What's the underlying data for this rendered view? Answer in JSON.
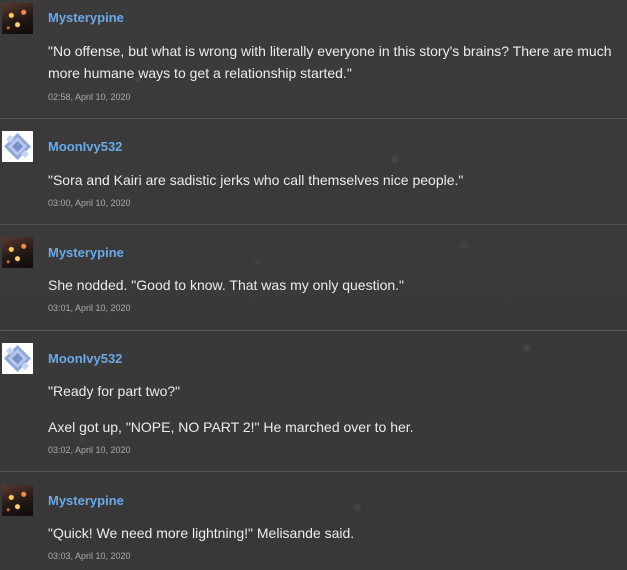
{
  "comments": [
    {
      "username": "Mysterypine",
      "avatar_icon": "pine-avatar-icon",
      "paragraphs": [
        "\"No offense, but what is wrong with literally everyone in this story's brains? There are much more humane ways to get a relationship started.\""
      ],
      "timestamp": "02:58, April 10, 2020"
    },
    {
      "username": "MoonIvy532",
      "avatar_icon": "moon-avatar-icon",
      "paragraphs": [
        "\"Sora and Kairi are sadistic jerks who call themselves nice people.\""
      ],
      "timestamp": "03:00, April 10, 2020"
    },
    {
      "username": "Mysterypine",
      "avatar_icon": "pine-avatar-icon",
      "paragraphs": [
        "She nodded. \"Good to know. That was my only question.\""
      ],
      "timestamp": "03:01, April 10, 2020"
    },
    {
      "username": "MoonIvy532",
      "avatar_icon": "moon-avatar-icon",
      "paragraphs": [
        "\"Ready for part two?\"",
        "Axel got up, \"NOPE, NO PART 2!\" He marched over to her."
      ],
      "timestamp": "03:02, April 10, 2020"
    },
    {
      "username": "Mysterypine",
      "avatar_icon": "pine-avatar-icon",
      "paragraphs": [
        "\"Quick! We need more lightning!\" Melisande said."
      ],
      "timestamp": "03:03, April 10, 2020"
    }
  ],
  "colors": {
    "background": "#3a3a3a",
    "username": "#6aa8e8",
    "text": "#ececec",
    "timestamp": "#a9a9a9",
    "divider": "#555555"
  }
}
